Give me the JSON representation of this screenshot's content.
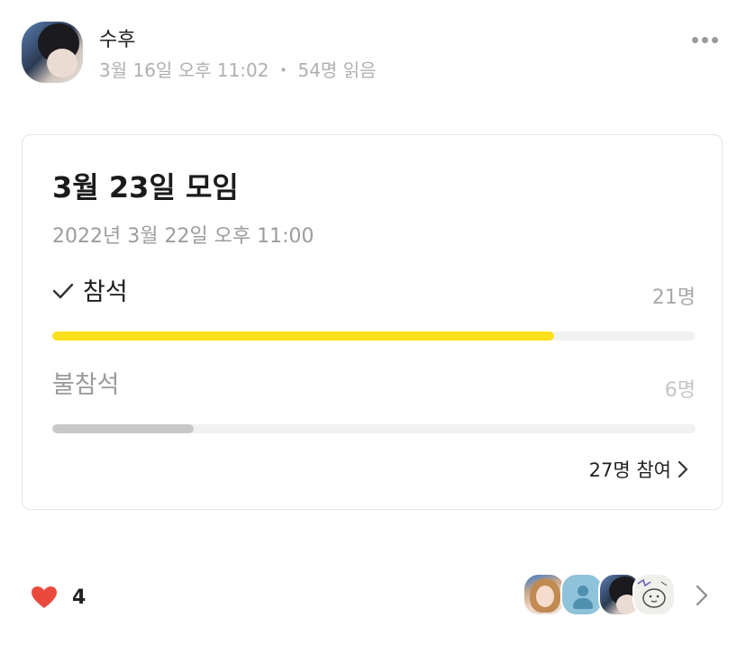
{
  "post": {
    "author_name": "수후",
    "timestamp": "3월 16일 오후 11:02",
    "separator": "・",
    "read_count": "54명 읽음",
    "more_icon": "more-horizontal-icon"
  },
  "poll": {
    "title": "3월 23일 모임",
    "datetime": "2022년 3월 22일 오후 11:00",
    "options": [
      {
        "label": "참석",
        "count": "21명",
        "fraction": 0.78,
        "selected": true,
        "icon": "check-icon"
      },
      {
        "label": "불참석",
        "count": "6명",
        "fraction": 0.22,
        "selected": false
      }
    ],
    "participants_link": "27명 참여",
    "colors": {
      "selected_fill": "#fae01a",
      "unselected_fill": "#c8c8c8",
      "track": "#f1f1f1"
    }
  },
  "footer": {
    "like_count": "4",
    "like_icon": "heart-icon",
    "reactor_count": 4,
    "nav_icon": "chevron-right-icon",
    "colors": {
      "heart": "#ea4a3e"
    }
  }
}
